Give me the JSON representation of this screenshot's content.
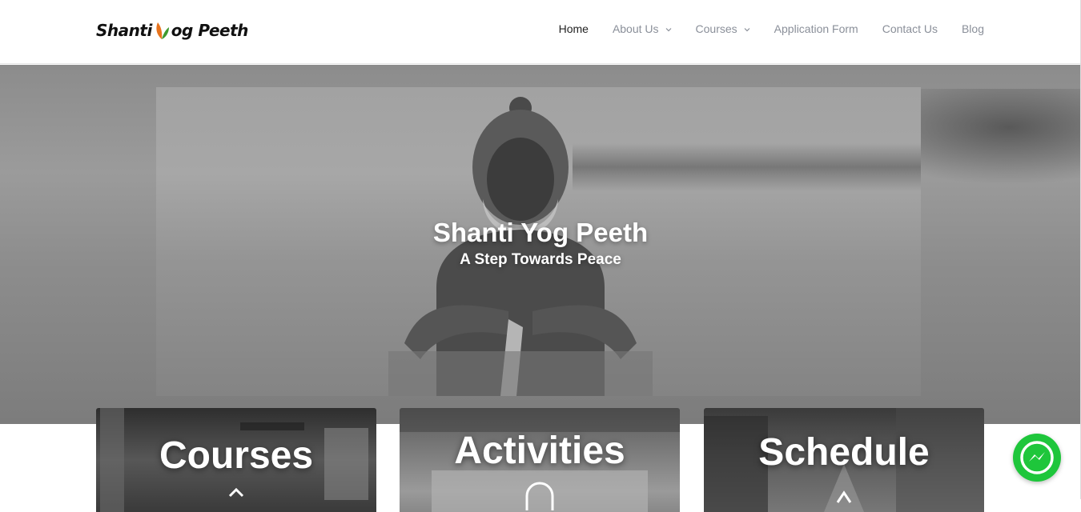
{
  "header": {
    "logo": {
      "part1": "Shanti",
      "part2": "og Peeth"
    },
    "nav": [
      {
        "label": "Home",
        "active": true,
        "dropdown": false
      },
      {
        "label": "About Us",
        "active": false,
        "dropdown": true
      },
      {
        "label": "Courses",
        "active": false,
        "dropdown": true
      },
      {
        "label": "Application Form",
        "active": false,
        "dropdown": false
      },
      {
        "label": "Contact Us",
        "active": false,
        "dropdown": false
      },
      {
        "label": "Blog",
        "active": false,
        "dropdown": false
      }
    ]
  },
  "hero": {
    "title": "Shanti Yog Peeth",
    "subtitle": "A Step Towards Peace"
  },
  "cards": [
    {
      "title": "Courses",
      "icon": "arrow-up-icon"
    },
    {
      "title": "Activities",
      "icon": "arch-icon"
    },
    {
      "title": "Schedule",
      "icon": "triangle-icon"
    }
  ],
  "messenger": {
    "icon": "messenger-icon",
    "color": "#1ec63b"
  },
  "colors": {
    "nav_text": "#8a8f99",
    "nav_active": "#222222",
    "leaf_orange": "#e8731c",
    "leaf_green": "#3f9a2f"
  }
}
